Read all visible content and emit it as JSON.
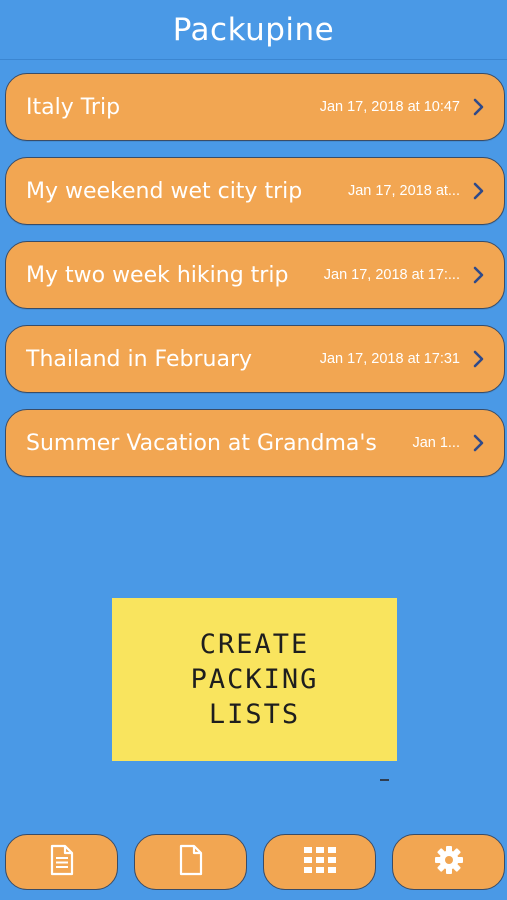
{
  "header": {
    "title": "Packupine"
  },
  "trips": [
    {
      "name": "Italy Trip",
      "date": "Jan 17, 2018 at 10:47"
    },
    {
      "name": "My weekend wet city trip",
      "date": "Jan 17, 2018 at..."
    },
    {
      "name": "My two week hiking trip",
      "date": "Jan 17, 2018 at 17:..."
    },
    {
      "name": "Thailand in February",
      "date": "Jan 17, 2018 at 17:31"
    },
    {
      "name": "Summer Vacation at Grandma's",
      "date": "Jan 1..."
    }
  ],
  "sticky_note": {
    "lines": [
      "CREATE",
      "PACKING",
      "LISTS"
    ]
  },
  "bottom_bar": {
    "buttons": [
      {
        "icon": "document-list-icon"
      },
      {
        "icon": "blank-document-icon"
      },
      {
        "icon": "grid-icon"
      },
      {
        "icon": "gear-icon"
      }
    ]
  },
  "colors": {
    "background": "#4a99e6",
    "item_fill": "#f2a652",
    "item_border": "#3a4c66",
    "chevron": "#2f4a8a",
    "sticky": "#f9e45e"
  }
}
